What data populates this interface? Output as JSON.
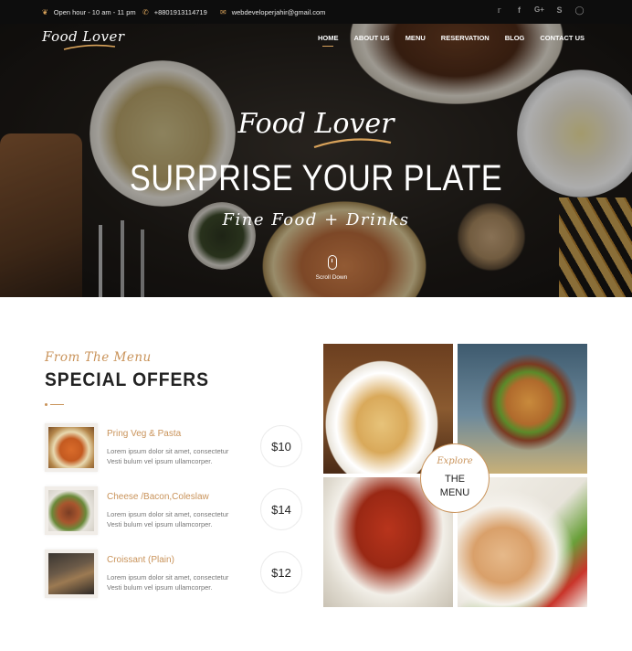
{
  "topbar": {
    "hours": "Open hour - 10 am - 11 pm",
    "phone": "+8801913114719",
    "email": "webdeveloperjahir@gmail.com",
    "socials": [
      "twitter-icon",
      "facebook-icon",
      "google-plus-icon",
      "skype-icon",
      "instagram-icon"
    ]
  },
  "header": {
    "logo": "Food Lover",
    "nav": [
      "HOME",
      "ABOUT US",
      "MENU",
      "RESERVATION",
      "BLOG",
      "CONTACT US"
    ],
    "active_nav": "HOME"
  },
  "hero": {
    "script": "Food Lover",
    "title": "SURPRISE YOUR PLATE",
    "subtitle": "Fine Food + Drinks",
    "scroll_label": "Scroll Down"
  },
  "menu_section": {
    "kicker": "From The Menu",
    "heading": "SPECIAL OFFERS",
    "items": [
      {
        "name": "Pring Veg & Pasta",
        "desc_line1": "Lorem ipsum dolor sit amet, consectetur",
        "desc_line2": "Vesti bulum vel ipsum ullamcorper.",
        "price": "$10"
      },
      {
        "name": "Cheese /Bacon,Coleslaw",
        "desc_line1": "Lorem ipsum dolor sit amet, consectetur",
        "desc_line2": "Vesti bulum vel ipsum ullamcorper.",
        "price": "$14"
      },
      {
        "name": "Croissant (Plain)",
        "desc_line1": "Lorem ipsum dolor sit amet, consectetur",
        "desc_line2": "Vesti bulum vel ipsum ullamcorper.",
        "price": "$12"
      }
    ]
  },
  "gallery": {
    "explore_script": "Explore",
    "explore_line1": "THE",
    "explore_line2": "MENU"
  },
  "colors": {
    "accent": "#c9935a",
    "topbar_bg": "#0d0d0d",
    "heading": "#222222"
  }
}
